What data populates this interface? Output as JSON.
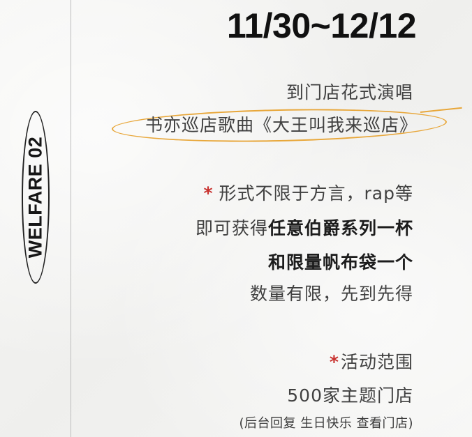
{
  "side_badge": {
    "label": "WELFARE 02"
  },
  "date_range": "11/30~12/12",
  "lines": {
    "line1": "到门店花式演唱",
    "line2": "书亦巡店歌曲《大王叫我来巡店》",
    "line3": "形式不限于方言，rap等",
    "line4_plain": "即可获得",
    "line4_bold": "任意伯爵系列一杯",
    "line5": "和限量帆布袋一个",
    "line6": "数量有限，先到先得",
    "line7": "活动范围",
    "line8": "500家主题门店",
    "line9": "(后台回复 生日快乐 查看门店)"
  },
  "star": "*",
  "colors": {
    "star": "#c8302d",
    "highlight": "#e8a73a",
    "text": "#404040",
    "bold_text": "#1c1c1c"
  }
}
